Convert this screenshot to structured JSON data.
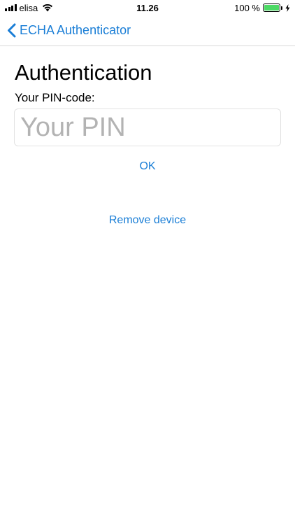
{
  "status_bar": {
    "carrier": "elisa",
    "time": "11.26",
    "battery_percent": "100 %",
    "battery_level": 1.0,
    "battery_color": "#4cd964",
    "icons": [
      "signal-icon",
      "wifi-icon",
      "battery-icon",
      "charging-bolt-icon"
    ]
  },
  "nav": {
    "back_label": "ECHA Authenticator",
    "back_icon": "chevron-left-icon",
    "accent_color": "#1a7ed6"
  },
  "main": {
    "title": "Authentication",
    "pin_label": "Your PIN-code:",
    "pin_value": "",
    "pin_placeholder": "Your PIN",
    "ok_label": "OK",
    "remove_label": "Remove device"
  }
}
